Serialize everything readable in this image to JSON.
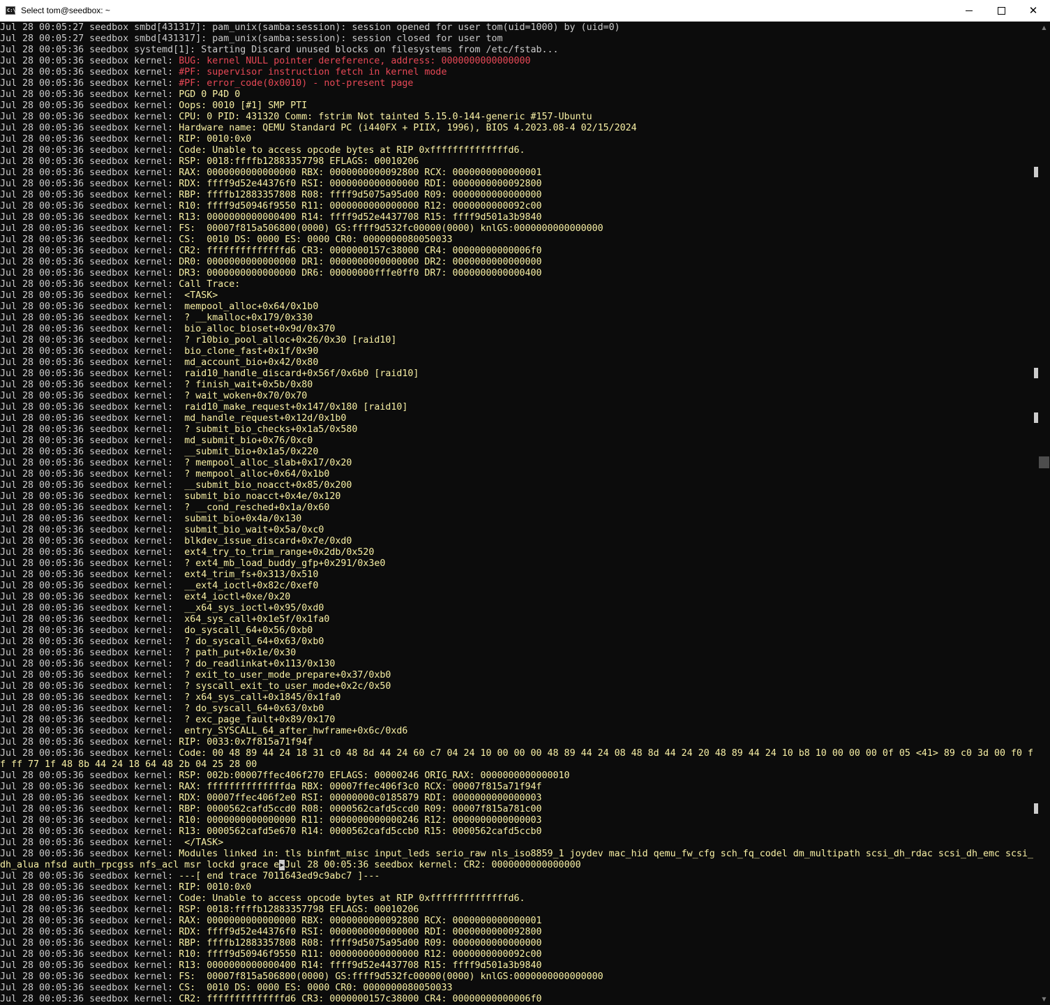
{
  "window": {
    "title": "Select tom@seedbox: ~",
    "icon_label": "C:\\",
    "controls": {
      "minimize": "minimize",
      "maximize": "maximize",
      "close": "✕"
    }
  },
  "colors": {
    "background": "#0c0c0c",
    "default_text": "#cccccc",
    "kernel_error_red": "#e74856",
    "kernel_warn_yellow": "#f9f1a5"
  },
  "terminal": {
    "lines": [
      {
        "text": "Jul 28 00:05:27 seedbox smbd[431317]: pam_unix(samba:session): session opened for user tom(uid=1000) by (uid=0)",
        "style": "default"
      },
      {
        "text": "Jul 28 00:05:27 seedbox smbd[431317]: pam_unix(samba:session): session closed for user tom",
        "style": "default"
      },
      {
        "text": "Jul 28 00:05:36 seedbox systemd[1]: Starting Discard unused blocks on filesystems from /etc/fstab...",
        "style": "default"
      },
      {
        "prefix": "Jul 28 00:05:36 seedbox kernel: ",
        "text": "BUG: kernel NULL pointer dereference, address: 0000000000000000",
        "style": "red"
      },
      {
        "prefix": "Jul 28 00:05:36 seedbox kernel: ",
        "text": "#PF: supervisor instruction fetch in kernel mode",
        "style": "red"
      },
      {
        "prefix": "Jul 28 00:05:36 seedbox kernel: ",
        "text": "#PF: error_code(0x0010) - not-present page",
        "style": "red"
      },
      {
        "prefix": "Jul 28 00:05:36 seedbox kernel: ",
        "text": "PGD 0 P4D 0",
        "style": "yellow"
      },
      {
        "prefix": "Jul 28 00:05:36 seedbox kernel: ",
        "text": "Oops: 0010 [#1] SMP PTI",
        "style": "yellow"
      },
      {
        "prefix": "Jul 28 00:05:36 seedbox kernel: ",
        "text": "CPU: 0 PID: 431320 Comm: fstrim Not tainted 5.15.0-144-generic #157-Ubuntu",
        "style": "yellow"
      },
      {
        "prefix": "Jul 28 00:05:36 seedbox kernel: ",
        "text": "Hardware name: QEMU Standard PC (i440FX + PIIX, 1996), BIOS 4.2023.08-4 02/15/2024",
        "style": "yellow"
      },
      {
        "prefix": "Jul 28 00:05:36 seedbox kernel: ",
        "text": "RIP: 0010:0x0",
        "style": "yellow"
      },
      {
        "prefix": "Jul 28 00:05:36 seedbox kernel: ",
        "text": "Code: Unable to access opcode bytes at RIP 0xffffffffffffffd6.",
        "style": "yellow"
      },
      {
        "prefix": "Jul 28 00:05:36 seedbox kernel: ",
        "text": "RSP: 0018:ffffb12883357798 EFLAGS: 00010206",
        "style": "yellow"
      },
      {
        "prefix": "Jul 28 00:05:36 seedbox kernel: ",
        "text": "RAX: 0000000000000000 RBX: 0000000000092800 RCX: 0000000000000001",
        "style": "yellow"
      },
      {
        "prefix": "Jul 28 00:05:36 seedbox kernel: ",
        "text": "RDX: ffff9d52e44376f0 RSI: 0000000000000000 RDI: 0000000000092800",
        "style": "yellow"
      },
      {
        "prefix": "Jul 28 00:05:36 seedbox kernel: ",
        "text": "RBP: ffffb12883357808 R08: ffff9d5075a95d00 R09: 0000000000000000",
        "style": "yellow"
      },
      {
        "prefix": "Jul 28 00:05:36 seedbox kernel: ",
        "text": "R10: ffff9d50946f9550 R11: 0000000000000000 R12: 0000000000092c00",
        "style": "yellow"
      },
      {
        "prefix": "Jul 28 00:05:36 seedbox kernel: ",
        "text": "R13: 0000000000000400 R14: ffff9d52e4437708 R15: ffff9d501a3b9840",
        "style": "yellow"
      },
      {
        "prefix": "Jul 28 00:05:36 seedbox kernel: ",
        "text": "FS:  00007f815a506800(0000) GS:ffff9d532fc00000(0000) knlGS:0000000000000000",
        "style": "yellow"
      },
      {
        "prefix": "Jul 28 00:05:36 seedbox kernel: ",
        "text": "CS:  0010 DS: 0000 ES: 0000 CR0: 0000000080050033",
        "style": "yellow"
      },
      {
        "prefix": "Jul 28 00:05:36 seedbox kernel: ",
        "text": "CR2: ffffffffffffffd6 CR3: 0000000157c38000 CR4: 00000000000006f0",
        "style": "yellow"
      },
      {
        "prefix": "Jul 28 00:05:36 seedbox kernel: ",
        "text": "DR0: 0000000000000000 DR1: 0000000000000000 DR2: 0000000000000000",
        "style": "yellow"
      },
      {
        "prefix": "Jul 28 00:05:36 seedbox kernel: ",
        "text": "DR3: 0000000000000000 DR6: 00000000fffe0ff0 DR7: 0000000000000400",
        "style": "yellow"
      },
      {
        "prefix": "Jul 28 00:05:36 seedbox kernel: ",
        "text": "Call Trace:",
        "style": "yellow"
      },
      {
        "prefix": "Jul 28 00:05:36 seedbox kernel: ",
        "text": " <TASK>",
        "style": "yellow"
      },
      {
        "prefix": "Jul 28 00:05:36 seedbox kernel: ",
        "text": " mempool_alloc+0x64/0x1b0",
        "style": "yellow"
      },
      {
        "prefix": "Jul 28 00:05:36 seedbox kernel: ",
        "text": " ? __kmalloc+0x179/0x330",
        "style": "yellow"
      },
      {
        "prefix": "Jul 28 00:05:36 seedbox kernel: ",
        "text": " bio_alloc_bioset+0x9d/0x370",
        "style": "yellow"
      },
      {
        "prefix": "Jul 28 00:05:36 seedbox kernel: ",
        "text": " ? r10bio_pool_alloc+0x26/0x30 [raid10]",
        "style": "yellow"
      },
      {
        "prefix": "Jul 28 00:05:36 seedbox kernel: ",
        "text": " bio_clone_fast+0x1f/0x90",
        "style": "yellow"
      },
      {
        "prefix": "Jul 28 00:05:36 seedbox kernel: ",
        "text": " md_account_bio+0x42/0x80",
        "style": "yellow"
      },
      {
        "prefix": "Jul 28 00:05:36 seedbox kernel: ",
        "text": " raid10_handle_discard+0x56f/0x6b0 [raid10]",
        "style": "yellow"
      },
      {
        "prefix": "Jul 28 00:05:36 seedbox kernel: ",
        "text": " ? finish_wait+0x5b/0x80",
        "style": "yellow"
      },
      {
        "prefix": "Jul 28 00:05:36 seedbox kernel: ",
        "text": " ? wait_woken+0x70/0x70",
        "style": "yellow"
      },
      {
        "prefix": "Jul 28 00:05:36 seedbox kernel: ",
        "text": " raid10_make_request+0x147/0x180 [raid10]",
        "style": "yellow"
      },
      {
        "prefix": "Jul 28 00:05:36 seedbox kernel: ",
        "text": " md_handle_request+0x12d/0x1b0",
        "style": "yellow"
      },
      {
        "prefix": "Jul 28 00:05:36 seedbox kernel: ",
        "text": " ? submit_bio_checks+0x1a5/0x580",
        "style": "yellow"
      },
      {
        "prefix": "Jul 28 00:05:36 seedbox kernel: ",
        "text": " md_submit_bio+0x76/0xc0",
        "style": "yellow"
      },
      {
        "prefix": "Jul 28 00:05:36 seedbox kernel: ",
        "text": " __submit_bio+0x1a5/0x220",
        "style": "yellow"
      },
      {
        "prefix": "Jul 28 00:05:36 seedbox kernel: ",
        "text": " ? mempool_alloc_slab+0x17/0x20",
        "style": "yellow"
      },
      {
        "prefix": "Jul 28 00:05:36 seedbox kernel: ",
        "text": " ? mempool_alloc+0x64/0x1b0",
        "style": "yellow"
      },
      {
        "prefix": "Jul 28 00:05:36 seedbox kernel: ",
        "text": " __submit_bio_noacct+0x85/0x200",
        "style": "yellow"
      },
      {
        "prefix": "Jul 28 00:05:36 seedbox kernel: ",
        "text": " submit_bio_noacct+0x4e/0x120",
        "style": "yellow"
      },
      {
        "prefix": "Jul 28 00:05:36 seedbox kernel: ",
        "text": " ? __cond_resched+0x1a/0x60",
        "style": "yellow"
      },
      {
        "prefix": "Jul 28 00:05:36 seedbox kernel: ",
        "text": " submit_bio+0x4a/0x130",
        "style": "yellow"
      },
      {
        "prefix": "Jul 28 00:05:36 seedbox kernel: ",
        "text": " submit_bio_wait+0x5a/0xc0",
        "style": "yellow"
      },
      {
        "prefix": "Jul 28 00:05:36 seedbox kernel: ",
        "text": " blkdev_issue_discard+0x7e/0xd0",
        "style": "yellow"
      },
      {
        "prefix": "Jul 28 00:05:36 seedbox kernel: ",
        "text": " ext4_try_to_trim_range+0x2db/0x520",
        "style": "yellow"
      },
      {
        "prefix": "Jul 28 00:05:36 seedbox kernel: ",
        "text": " ? ext4_mb_load_buddy_gfp+0x291/0x3e0",
        "style": "yellow"
      },
      {
        "prefix": "Jul 28 00:05:36 seedbox kernel: ",
        "text": " ext4_trim_fs+0x313/0x510",
        "style": "yellow"
      },
      {
        "prefix": "Jul 28 00:05:36 seedbox kernel: ",
        "text": " __ext4_ioctl+0x82c/0xef0",
        "style": "yellow"
      },
      {
        "prefix": "Jul 28 00:05:36 seedbox kernel: ",
        "text": " ext4_ioctl+0xe/0x20",
        "style": "yellow"
      },
      {
        "prefix": "Jul 28 00:05:36 seedbox kernel: ",
        "text": " __x64_sys_ioctl+0x95/0xd0",
        "style": "yellow"
      },
      {
        "prefix": "Jul 28 00:05:36 seedbox kernel: ",
        "text": " x64_sys_call+0x1e5f/0x1fa0",
        "style": "yellow"
      },
      {
        "prefix": "Jul 28 00:05:36 seedbox kernel: ",
        "text": " do_syscall_64+0x56/0xb0",
        "style": "yellow"
      },
      {
        "prefix": "Jul 28 00:05:36 seedbox kernel: ",
        "text": " ? do_syscall_64+0x63/0xb0",
        "style": "yellow"
      },
      {
        "prefix": "Jul 28 00:05:36 seedbox kernel: ",
        "text": " ? path_put+0x1e/0x30",
        "style": "yellow"
      },
      {
        "prefix": "Jul 28 00:05:36 seedbox kernel: ",
        "text": " ? do_readlinkat+0x113/0x130",
        "style": "yellow"
      },
      {
        "prefix": "Jul 28 00:05:36 seedbox kernel: ",
        "text": " ? exit_to_user_mode_prepare+0x37/0xb0",
        "style": "yellow"
      },
      {
        "prefix": "Jul 28 00:05:36 seedbox kernel: ",
        "text": " ? syscall_exit_to_user_mode+0x2c/0x50",
        "style": "yellow"
      },
      {
        "prefix": "Jul 28 00:05:36 seedbox kernel: ",
        "text": " ? x64_sys_call+0x1845/0x1fa0",
        "style": "yellow"
      },
      {
        "prefix": "Jul 28 00:05:36 seedbox kernel: ",
        "text": " ? do_syscall_64+0x63/0xb0",
        "style": "yellow"
      },
      {
        "prefix": "Jul 28 00:05:36 seedbox kernel: ",
        "text": " ? exc_page_fault+0x89/0x170",
        "style": "yellow"
      },
      {
        "prefix": "Jul 28 00:05:36 seedbox kernel: ",
        "text": " entry_SYSCALL_64_after_hwframe+0x6c/0xd6",
        "style": "yellow"
      },
      {
        "prefix": "Jul 28 00:05:36 seedbox kernel: ",
        "text": "RIP: 0033:0x7f815a71f94f",
        "style": "yellow"
      },
      {
        "prefix": "Jul 28 00:05:36 seedbox kernel: ",
        "text": "Code: 00 48 89 44 24 18 31 c0 48 8d 44 24 60 c7 04 24 10 00 00 00 48 89 44 24 08 48 8d 44 24 20 48 89 44 24 10 b8 10 00 00 00 0f 05 <41> 89 c0 3d 00 f0 f",
        "style": "yellow"
      },
      {
        "text": "f ff 77 1f 48 8b 44 24 18 64 48 2b 04 25 28 00",
        "style": "yellow"
      },
      {
        "prefix": "Jul 28 00:05:36 seedbox kernel: ",
        "text": "RSP: 002b:00007ffec406f270 EFLAGS: 00000246 ORIG_RAX: 0000000000000010",
        "style": "yellow"
      },
      {
        "prefix": "Jul 28 00:05:36 seedbox kernel: ",
        "text": "RAX: ffffffffffffffda RBX: 00007ffec406f3c0 RCX: 00007f815a71f94f",
        "style": "yellow"
      },
      {
        "prefix": "Jul 28 00:05:36 seedbox kernel: ",
        "text": "RDX: 00007ffec406f2e0 RSI: 00000000c0185879 RDI: 0000000000000003",
        "style": "yellow"
      },
      {
        "prefix": "Jul 28 00:05:36 seedbox kernel: ",
        "text": "RBP: 0000562cafd5ccd0 R08: 0000562cafd5ccd0 R09: 00007f815a781c00",
        "style": "yellow"
      },
      {
        "prefix": "Jul 28 00:05:36 seedbox kernel: ",
        "text": "R10: 0000000000000000 R11: 0000000000000246 R12: 0000000000000003",
        "style": "yellow"
      },
      {
        "prefix": "Jul 28 00:05:36 seedbox kernel: ",
        "text": "R13: 0000562cafd5e670 R14: 0000562cafd5ccb0 R15: 0000562cafd5ccb0",
        "style": "yellow"
      },
      {
        "prefix": "Jul 28 00:05:36 seedbox kernel: ",
        "text": " </TASK>",
        "style": "yellow"
      },
      {
        "prefix": "Jul 28 00:05:36 seedbox kernel: ",
        "text": "Modules linked in: tls binfmt_misc input_leds serio_raw nls_iso8859_1 joydev mac_hid qemu_fw_cfg sch_fq_codel dm_multipath scsi_dh_rdac scsi_dh_emc scsi_",
        "style": "yellow"
      },
      {
        "text": "dh_alua nfsd auth_rpcgss nfs_acl msr lockd grace e",
        "cursor": "▸",
        "after": "Jul 28 00:05:36 seedbox kernel: CR2: 0000000000000000",
        "style": "yellow"
      },
      {
        "prefix": "Jul 28 00:05:36 seedbox kernel: ",
        "text": "---[ end trace 7011643ed9c9abc7 ]---",
        "style": "yellow"
      },
      {
        "prefix": "Jul 28 00:05:36 seedbox kernel: ",
        "text": "RIP: 0010:0x0",
        "style": "yellow"
      },
      {
        "prefix": "Jul 28 00:05:36 seedbox kernel: ",
        "text": "Code: Unable to access opcode bytes at RIP 0xffffffffffffffd6.",
        "style": "yellow"
      },
      {
        "prefix": "Jul 28 00:05:36 seedbox kernel: ",
        "text": "RSP: 0018:ffffb12883357798 EFLAGS: 00010206",
        "style": "yellow"
      },
      {
        "prefix": "Jul 28 00:05:36 seedbox kernel: ",
        "text": "RAX: 0000000000000000 RBX: 0000000000092800 RCX: 0000000000000001",
        "style": "yellow"
      },
      {
        "prefix": "Jul 28 00:05:36 seedbox kernel: ",
        "text": "RDX: ffff9d52e44376f0 RSI: 0000000000000000 RDI: 0000000000092800",
        "style": "yellow"
      },
      {
        "prefix": "Jul 28 00:05:36 seedbox kernel: ",
        "text": "RBP: ffffb12883357808 R08: ffff9d5075a95d00 R09: 0000000000000000",
        "style": "yellow"
      },
      {
        "prefix": "Jul 28 00:05:36 seedbox kernel: ",
        "text": "R10: ffff9d50946f9550 R11: 0000000000000000 R12: 0000000000092c00",
        "style": "yellow"
      },
      {
        "prefix": "Jul 28 00:05:36 seedbox kernel: ",
        "text": "R13: 0000000000000400 R14: ffff9d52e4437708 R15: ffff9d501a3b9840",
        "style": "yellow"
      },
      {
        "prefix": "Jul 28 00:05:36 seedbox kernel: ",
        "text": "FS:  00007f815a506800(0000) GS:ffff9d532fc00000(0000) knlGS:0000000000000000",
        "style": "yellow"
      },
      {
        "prefix": "Jul 28 00:05:36 seedbox kernel: ",
        "text": "CS:  0010 DS: 0000 ES: 0000 CR0: 0000000080050033",
        "style": "yellow"
      },
      {
        "prefix": "Jul 28 00:05:36 seedbox kernel: ",
        "text": "CR2: ffffffffffffffd6 CR3: 0000000157c38000 CR4: 00000000000006f0",
        "style": "yellow"
      }
    ]
  }
}
